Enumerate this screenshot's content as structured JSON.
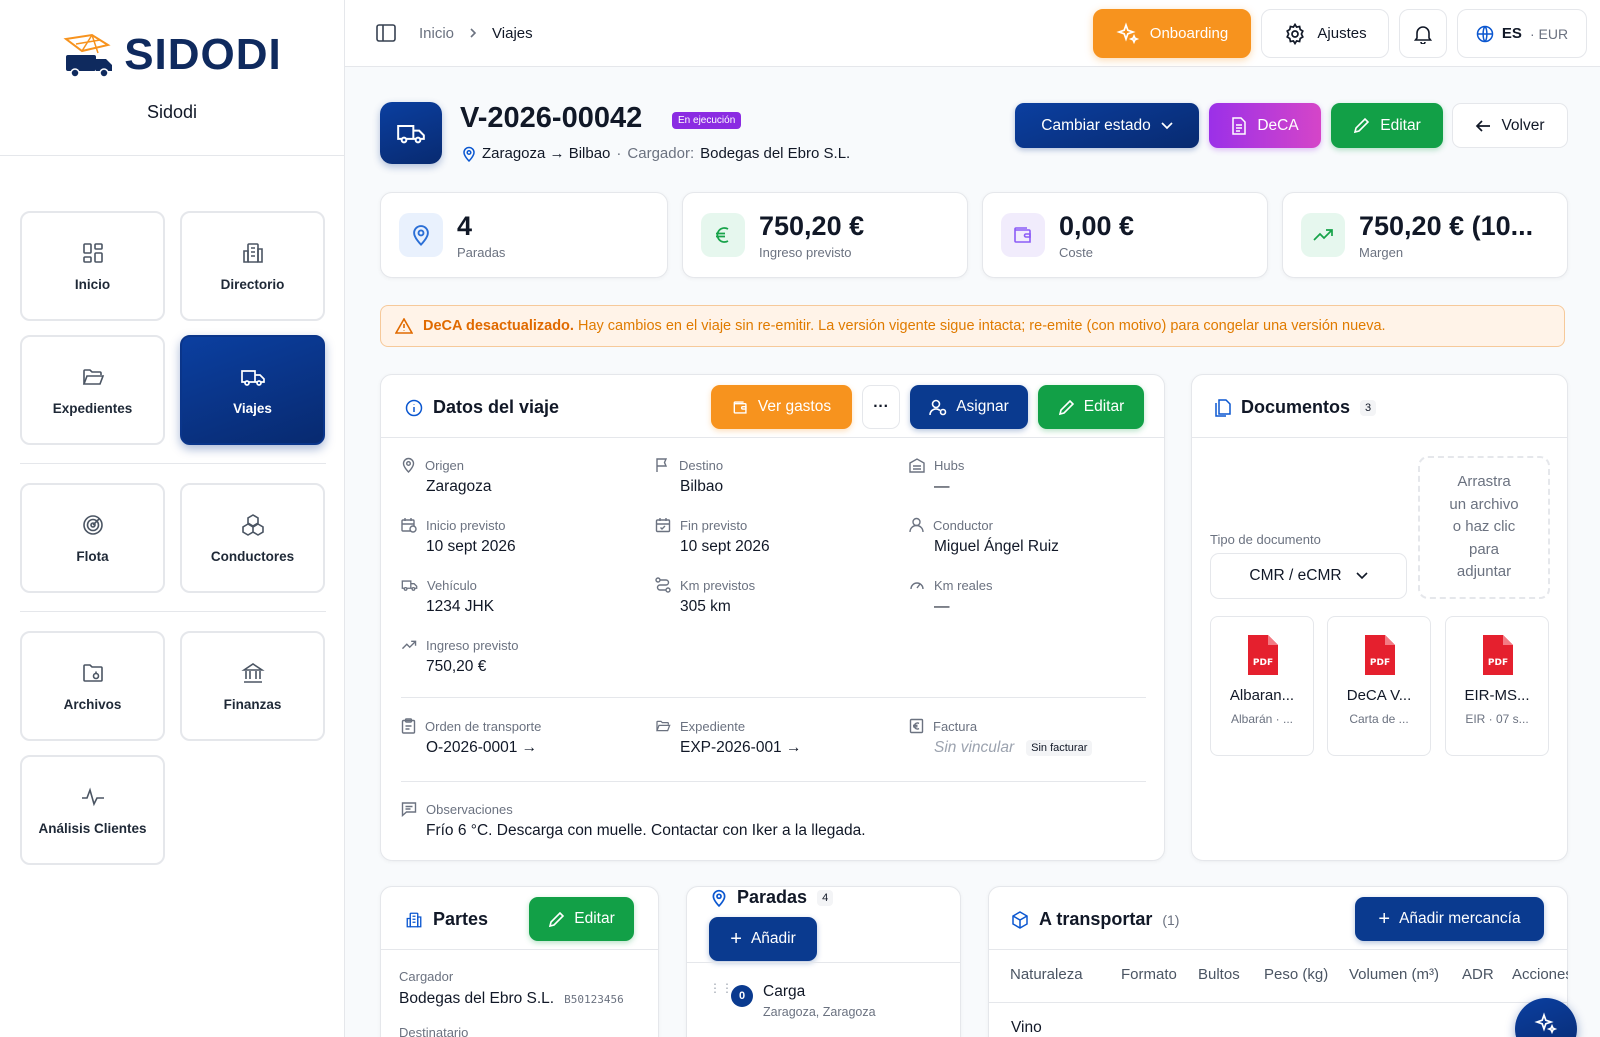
{
  "brand": {
    "logo_text": "SIDODI",
    "org_name": "Sidodi"
  },
  "nav": [
    {
      "label": "Inicio",
      "icon": "grid-icon"
    },
    {
      "label": "Directorio",
      "icon": "building-icon"
    },
    {
      "label": "Expedientes",
      "icon": "folder-open-icon"
    },
    {
      "label": "Viajes",
      "icon": "truck-icon",
      "active": true
    },
    {
      "label": "Flota",
      "icon": "target-icon"
    },
    {
      "label": "Conductores",
      "icon": "boxes-icon"
    },
    {
      "label": "Archivos",
      "icon": "folder-icon"
    },
    {
      "label": "Finanzas",
      "icon": "bank-icon"
    },
    {
      "label": "Análisis Clientes",
      "icon": "pulse-icon"
    }
  ],
  "topbar": {
    "breadcrumb": [
      "Inicio",
      "Viajes"
    ],
    "onboarding": "Onboarding",
    "settings": "Ajustes",
    "lang": "ES",
    "currency": "· EUR"
  },
  "trip": {
    "id": "V-2026-00042",
    "state": "En ejecución",
    "route": "Zaragoza → Bilbao",
    "shipper_label": "Cargador:",
    "shipper": "Bodegas del Ebro S.L.",
    "actions": {
      "change_state": "Cambiar estado",
      "deca": "DeCA",
      "edit": "Editar",
      "back": "Volver"
    }
  },
  "stats": [
    {
      "value": "4",
      "label": "Paradas"
    },
    {
      "value": "750,20 €",
      "label": "Ingreso previsto"
    },
    {
      "value": "0,00 €",
      "label": "Coste"
    },
    {
      "value": "750,20 € (10...",
      "label": "Margen"
    }
  ],
  "alert": {
    "title": "DeCA desactualizado.",
    "text": "Hay cambios en el viaje sin re-emitir. La versión vigente sigue intacta; re-emite (con motivo) para congelar una versión nueva."
  },
  "details": {
    "title": "Datos del viaje",
    "btn_expenses": "Ver gastos",
    "btn_more": "···",
    "btn_assign": "Asignar",
    "btn_edit": "Editar",
    "fields": {
      "origin": {
        "label": "Origen",
        "value": "Zaragoza"
      },
      "dest": {
        "label": "Destino",
        "value": "Bilbao"
      },
      "hubs": {
        "label": "Hubs",
        "value": "—"
      },
      "start": {
        "label": "Inicio previsto",
        "value": "10 sept 2026"
      },
      "end": {
        "label": "Fin previsto",
        "value": "10 sept 2026"
      },
      "driver": {
        "label": "Conductor",
        "value": "Miguel Ángel Ruiz"
      },
      "vehicle": {
        "label": "Vehículo",
        "value": "1234 JHK"
      },
      "km_plan": {
        "label": "Km previstos",
        "value": "305 km"
      },
      "km_real": {
        "label": "Km reales",
        "value": "—"
      },
      "income": {
        "label": "Ingreso previsto",
        "value": "750,20 €"
      },
      "order": {
        "label": "Orden de transporte",
        "value": "O-2026-0001 →"
      },
      "file": {
        "label": "Expediente",
        "value": "EXP-2026-001 →"
      },
      "invoice": {
        "label": "Factura",
        "value": "Sin vincular",
        "badge": "Sin facturar"
      },
      "notes": {
        "label": "Observaciones",
        "value": "Frío 6 °C. Descarga con muelle. Contactar con Iker a la llegada."
      }
    }
  },
  "documents": {
    "title": "Documentos",
    "count": "3",
    "type_label": "Tipo de documento",
    "type_value": "CMR / eCMR",
    "drop_lines": [
      "Arrastra",
      "un archivo",
      "o haz clic",
      "para",
      "adjuntar"
    ],
    "items": [
      {
        "name": "Albaran...",
        "desc": "Albarán · ..."
      },
      {
        "name": "DeCA V...",
        "desc": "Carta de ..."
      },
      {
        "name": "EIR-MS...",
        "desc": "EIR · 07 s..."
      }
    ],
    "pdf": "PDF"
  },
  "parts": {
    "title": "Partes",
    "btn_edit": "Editar",
    "shipper_label": "Cargador",
    "shipper": "Bodegas del Ebro S.L.",
    "shipper_tax": "B50123456",
    "consignee_label": "Destinatario"
  },
  "stops": {
    "title": "Paradas",
    "count": "4",
    "btn_add": "Añadir",
    "first": {
      "index": "0",
      "type": "Carga",
      "place": "Zaragoza, Zaragoza"
    }
  },
  "cargo": {
    "title": "A transportar",
    "count": "(1)",
    "btn_add": "Añadir mercancía",
    "columns": [
      "Naturaleza",
      "Formato",
      "Bultos",
      "Peso (kg)",
      "Volumen (m³)",
      "ADR",
      "Acciones"
    ],
    "first_row": "Vino"
  },
  "colors": {
    "navy": "#0a3a8f",
    "orange": "#f7931e",
    "green": "#12a047",
    "purple": "#8b2be2"
  }
}
